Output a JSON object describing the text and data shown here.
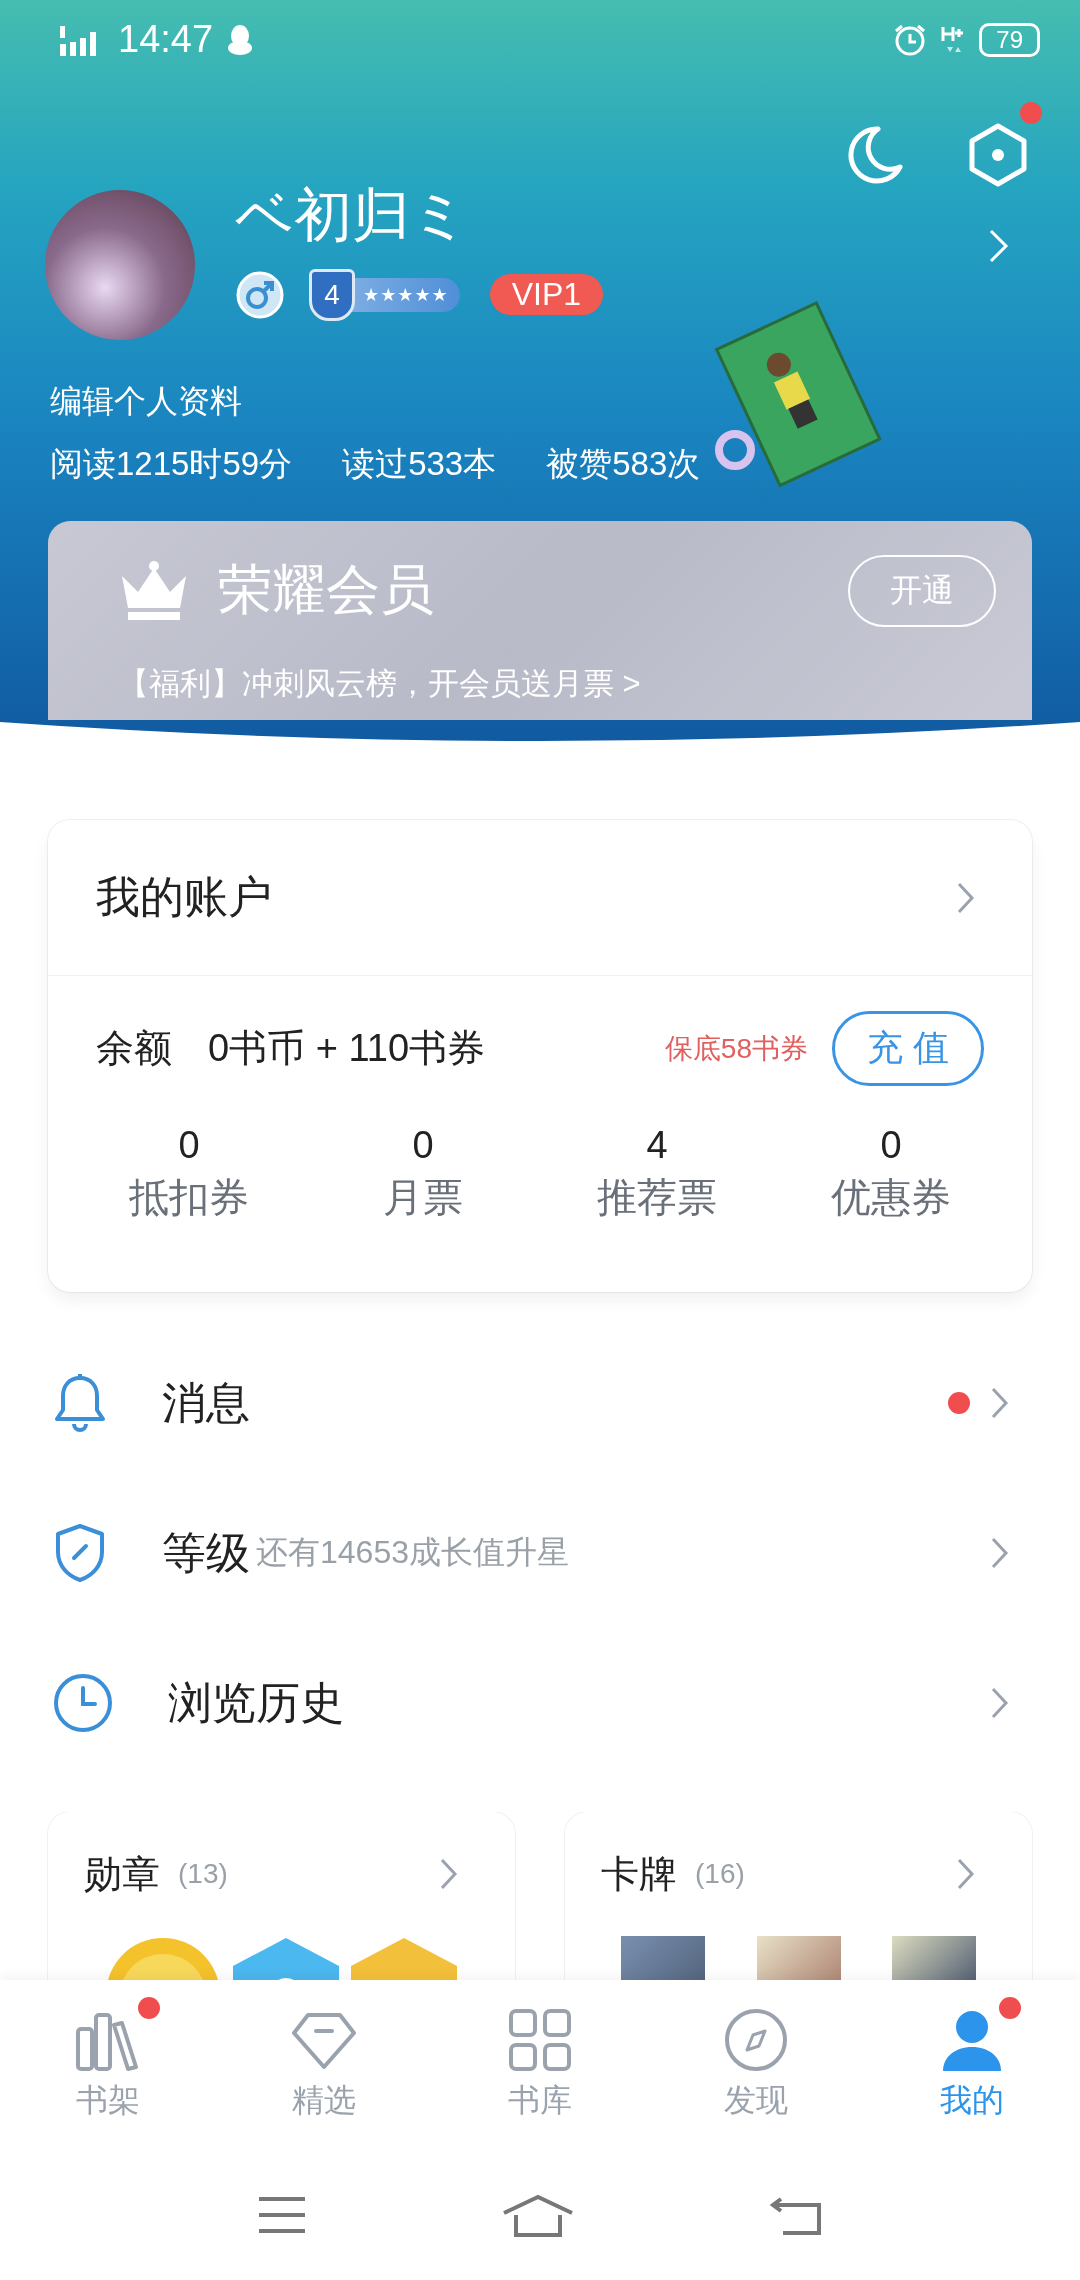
{
  "status_bar": {
    "time": "14:47",
    "battery": "79"
  },
  "header": {
    "settings_notification": true
  },
  "profile": {
    "name": "ベ初归ミ",
    "level": "4",
    "stars": 5,
    "vip": "VIP1",
    "edit_link": "编辑个人资料",
    "stats": [
      "阅读1215时59分",
      "读过533本",
      "被赞583次"
    ]
  },
  "membership": {
    "title": "荣耀会员",
    "button": "开通",
    "promo": "【福利】冲刺风云榜，开会员送月票 >"
  },
  "account": {
    "title": "我的账户",
    "balance_label": "余额",
    "balance": "0书币 + 110书券",
    "guarantee": "保底58书券",
    "recharge_button": "充 值",
    "stats": [
      {
        "value": "0",
        "label": "抵扣券"
      },
      {
        "value": "0",
        "label": "月票"
      },
      {
        "value": "4",
        "label": "推荐票"
      },
      {
        "value": "0",
        "label": "优惠券"
      }
    ]
  },
  "menu": [
    {
      "kind": "message",
      "label": "消息",
      "unread": true
    },
    {
      "kind": "level",
      "label": "等级",
      "hint": "还有14653成长值升星",
      "unread": false
    },
    {
      "kind": "history",
      "label": "浏览历史",
      "unread": false
    }
  ],
  "collections": [
    {
      "kind": "medals",
      "title": "勋章",
      "count": "(13)"
    },
    {
      "kind": "cards",
      "title": "卡牌",
      "count": "(16)"
    }
  ],
  "tabs": [
    {
      "kind": "shelf",
      "label": "书架",
      "selected": false,
      "badge": true
    },
    {
      "kind": "featured",
      "label": "精选",
      "selected": false,
      "badge": false
    },
    {
      "kind": "library",
      "label": "书库",
      "selected": false,
      "badge": false
    },
    {
      "kind": "discover",
      "label": "发现",
      "selected": false,
      "badge": false
    },
    {
      "kind": "me",
      "label": "我的",
      "selected": true,
      "badge": true
    }
  ]
}
